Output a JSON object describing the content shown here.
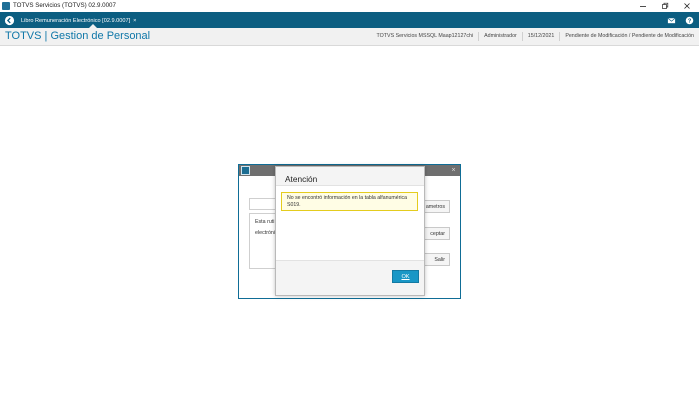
{
  "window": {
    "title": "TOTVS Servicios (TOTVS) 02.9.0007",
    "controls": [
      "minimize",
      "maximize",
      "close"
    ]
  },
  "tabbar": {
    "tab_label": "Libro Remuneración Electrónico [02.9.0007]",
    "tab_close": "×",
    "icons": [
      "back-icon",
      "mail-icon",
      "help-icon"
    ]
  },
  "header": {
    "brand": "TOTVS | Gestion de Personal",
    "environment": "TOTVS Servicios MSSQL Maap12127chi",
    "user": "Administrador",
    "date": "15/12/2021",
    "status": "Pendiente de Modificación / Pendiente de Modificación"
  },
  "background_dialog": {
    "text_line1": "Esta ruti",
    "text_line2": "electróni",
    "btn_params": "ametros",
    "btn_accept": "ceptar",
    "btn_exit": "Salir",
    "close": "×"
  },
  "modal": {
    "title": "Atención",
    "message": "No se encontró información en la tabla alfanumérica S019.",
    "ok": "OK"
  },
  "colors": {
    "tabbar_bg": "#0c5e81",
    "brand": "#0f77a8",
    "ok_button": "#1997c6",
    "message_border": "#e4cc1e"
  }
}
